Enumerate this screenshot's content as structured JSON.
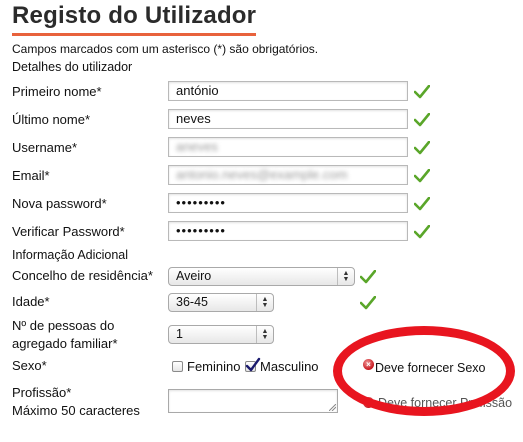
{
  "page": {
    "title": "Registo do Utilizador",
    "required_note": "Campos marcados com um asterisco (*) são obrigatórios."
  },
  "sections": {
    "details": "Detalhes do utilizador",
    "additional": "Informação Adicional"
  },
  "fields": {
    "first_name": {
      "label": "Primeiro nome*",
      "value": "antónio"
    },
    "last_name": {
      "label": "Último nome*",
      "value": "neves"
    },
    "username": {
      "label": "Username*",
      "value": "aneves"
    },
    "email": {
      "label": "Email*",
      "value": "antonio.neves@example.com"
    },
    "password": {
      "label": "Nova password*",
      "value": "•••••••••"
    },
    "password_confirm": {
      "label": "Verificar Password*",
      "value": "•••••••••"
    },
    "council": {
      "label": "Concelho de residência*",
      "value": "Aveiro"
    },
    "age": {
      "label": "Idade*",
      "value": "36-45"
    },
    "household_label_1": "Nº de pessoas do",
    "household_label_2": "agregado familiar*",
    "household": {
      "value": "1"
    },
    "sex": {
      "label": "Sexo*",
      "option_female": "Feminino",
      "option_male": "Masculino"
    },
    "profession": {
      "label": "Profissão*",
      "hint": "Máximo 50 caracteres"
    }
  },
  "errors": {
    "sex": "Deve fornecer Sexo",
    "profession": "Deve fornecer Profissão"
  },
  "colors": {
    "accent_rule": "#e8623c",
    "valid_check": "#5aa62a",
    "error": "#e8151f"
  }
}
